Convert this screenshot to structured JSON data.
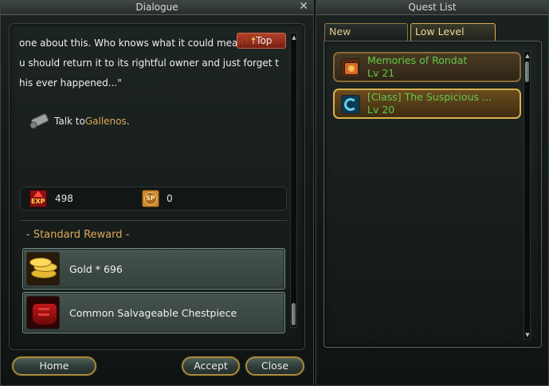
{
  "dialogue": {
    "title": "Dialogue",
    "close_glyph": "✕",
    "text_lines": [
      "one about this. Who knows what it could mean? P",
      "u should return it to its rightful owner and just forget t",
      "his ever happened...\""
    ],
    "top_button": "Top",
    "talk_prefix": "Talk to ",
    "talk_npc": "Gallenos",
    "talk_suffix": ".",
    "exp_icon_label": "EXP",
    "exp_value": "498",
    "sp_icon_label": "SP",
    "sp_value": "0",
    "reward_title": "- Standard Reward -",
    "rewards": [
      {
        "label": "Gold * 696",
        "icon": "gold-coins-icon"
      },
      {
        "label": "Common Salvageable Chestpiece",
        "icon": "chestpiece-icon"
      }
    ],
    "buttons": {
      "home": "Home",
      "accept": "Accept",
      "close": "Close"
    }
  },
  "quest_list": {
    "title": "Quest List",
    "tabs": [
      {
        "label": "New"
      },
      {
        "label": "Low Level"
      }
    ],
    "active_tab": "Low Level",
    "quests": [
      {
        "name": "Memories of Rondat",
        "level": "Lv 21",
        "icon": "quest-scroll-icon"
      },
      {
        "name": "[Class] The Suspicious ...",
        "level": "Lv 20",
        "icon": "class-quest-icon"
      }
    ]
  },
  "colors": {
    "npc_link": "#e0a95a",
    "quest_text": "#62c94a",
    "button_border": "#a88a3c"
  }
}
